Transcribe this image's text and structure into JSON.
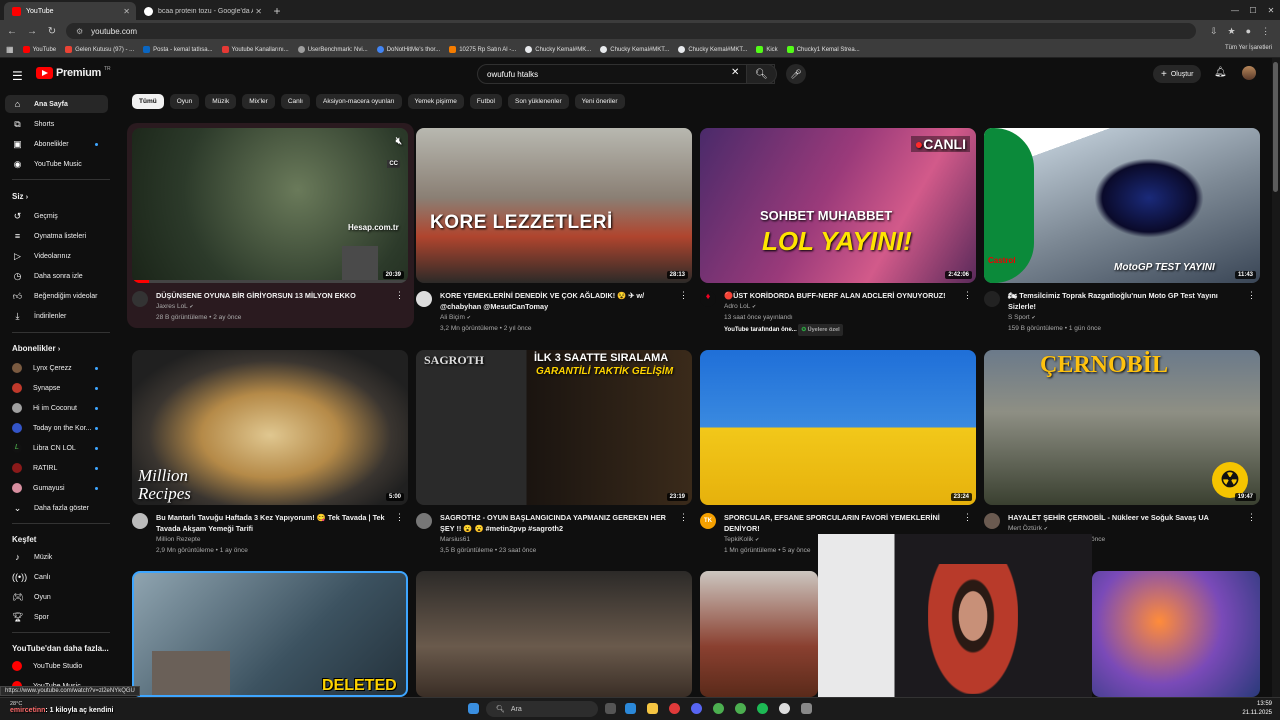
{
  "browser": {
    "tabs": [
      {
        "label": "YouTube",
        "active": true
      },
      {
        "label": "bcaa protein tozu - Google'da Ar",
        "active": false
      }
    ],
    "url": "youtube.com",
    "bookmarks": [
      "YouTube",
      "Gelen Kutusu (97) - ...",
      "Posta - kemal tatlısa...",
      "Youtube Kanallarını...",
      "UserBenchmark: Nvi...",
      "DoNotHitMe's thor...",
      "10275 Rp Satın Al -...",
      "Chucky Kemal#MK...",
      "Chucky Kemal#MKT...",
      "Chucky Kemal#MKT...",
      "Kick",
      "Chucky1 Kemal Strea..."
    ],
    "all_bookmarks": "Tüm Yer İşaretleri",
    "status_url": "https://www.youtube.com/watch?v=zl2eNYkQGU"
  },
  "header": {
    "logo": "Premium",
    "logo_region": "TR",
    "search_value": "owufufu htalks",
    "create_label": "Oluştur"
  },
  "sidebar": {
    "main": [
      "Ana Sayfa",
      "Shorts",
      "Abonelikler",
      "YouTube Music"
    ],
    "you_heading": "Siz",
    "you": [
      "Geçmiş",
      "Oynatma listeleri",
      "Videolarınız",
      "Daha sonra izle",
      "Beğendiğim videolar",
      "İndirilenler"
    ],
    "subs_heading": "Abonelikler",
    "subs": [
      "Lynx Çerezz",
      "Synapse",
      "Hi im Coconut",
      "Today on the Kor...",
      "Libra CN LOL",
      "RATIRL",
      "Gumayusi",
      "Daha fazla göster"
    ],
    "explore_heading": "Keşfet",
    "explore": [
      "Müzik",
      "Canlı",
      "Oyun",
      "Spor"
    ],
    "more_heading": "YouTube'dan daha fazla...",
    "more": [
      "YouTube Studio",
      "YouTube Music"
    ]
  },
  "chips": [
    "Tümü",
    "Oyun",
    "Müzik",
    "Mix'ler",
    "Canlı",
    "Aksiyon-macera oyunları",
    "Yemek pişirme",
    "Futbol",
    "Son yüklenenler",
    "Yeni öneriler"
  ],
  "videos": [
    {
      "title": "DÜŞÜNSENE OYUNA BİR GİRİYORSUN 13 MİLYON EKKO",
      "channel": "Jaxres LoL",
      "meta": "28 B görüntüleme • 2 ay önce",
      "duration": "20:39",
      "overlay": "Hesap.com.tr"
    },
    {
      "title": "KORE YEMEKLERİNİ DENEDİK VE ÇOK AĞLADIK! 😵 ✈ w/ @chabyhan @MesutCanTomay",
      "channel": "Ali Biçim",
      "meta": "3,2 Mn görüntüleme • 2 yıl önce",
      "duration": "28:13",
      "overlay": "KORE LEZZETLERİ"
    },
    {
      "title": "🔴ÜST KORİDORDA BUFF-NERF ALAN ADCLERİ OYNUYORUZ!",
      "channel": "Adro LoL",
      "meta": "13 saat önce yayınlandı",
      "meta2": "YouTube tarafından öne...",
      "badge": "Üyelere özel",
      "duration": "2:42:06",
      "overlay": "SOHBET MUHABBET",
      "overlay2": "LOL YAYINI!",
      "overlay3": "CANLI"
    },
    {
      "title": "🏍 Temsilcimiz Toprak Razgatlıoğlu'nun Moto GP Test Yayını Sizlerle!",
      "channel": "S Sport",
      "meta": "159 B görüntüleme • 1 gün önce",
      "duration": "11:43",
      "overlay": "MotoGP TEST YAYINI",
      "overlay2": "Castrol"
    },
    {
      "title": "Bu Mantarlı Tavuğu Haftada 3 Kez Yapıyorum! 😋 Tek Tavada | Tek Tavada Akşam Yemeği Tarifi",
      "channel": "Million Rezepte",
      "meta": "2,9 Mn görüntüleme • 1 ay önce",
      "duration": "5:00",
      "overlay": "Million",
      "overlay2": "Recipes"
    },
    {
      "title": "SAGROTH2 - OYUN BAŞLANGICINDA YAPMANIZ GEREKEN HER ŞEY !! 😮 😮 #metin2pvp #sagroth2",
      "channel": "Marsius61",
      "meta": "3,5 B görüntüleme • 23 saat önce",
      "duration": "23:19",
      "overlay": "İLK 3 SAATTE SIRALAMA",
      "overlay2": "GARANTİLİ TAKTİK GELİŞİM",
      "overlay3": "SAGROTH"
    },
    {
      "title": "SPORCULAR, EFSANE SPORCULARIN FAVORİ YEMEKLERİNİ DENİYOR!",
      "channel": "TepkiKolik",
      "meta": "1 Mn görüntüleme • 5 ay önce",
      "duration": "23:24"
    },
    {
      "title": "HAYALET ŞEHİR ÇERNOBİL - Nükleer ve Soğuk Savaş UA",
      "channel": "Mert Öztürk",
      "meta": "önce",
      "duration": "19:47",
      "overlay": "ÇERNOBİL"
    }
  ],
  "row3_overlay": "DELETED",
  "taskbar": {
    "weather": "28°C",
    "search_placeholder": "Ara",
    "time": "13:59",
    "date": "21.11.2025"
  },
  "chat": {
    "user": "emircetinn",
    "message": ": 1 kiloyla aç kendini"
  }
}
